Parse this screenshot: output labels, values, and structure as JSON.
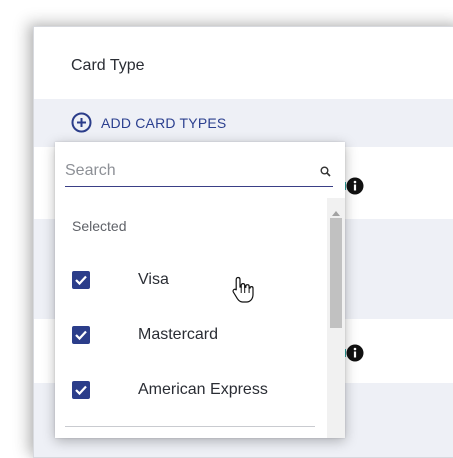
{
  "panel": {
    "card_type_title": "Card Type",
    "add_card_types_label": "ADD CARD TYPES"
  },
  "dropdown": {
    "search_placeholder": "Search",
    "selected_heading": "Selected",
    "options": [
      {
        "label": "Visa",
        "checked": true
      },
      {
        "label": "Mastercard",
        "checked": true
      },
      {
        "label": "American Express",
        "checked": true
      }
    ]
  },
  "icons": {
    "add": "plus-circle-icon",
    "search": "search-icon",
    "info": "info-icon",
    "check": "check-icon",
    "cursor": "hand-pointer-icon"
  },
  "colors": {
    "accent": "#2b3d8a",
    "row_alt": "#eef0f6",
    "text": "#2a2d34"
  }
}
